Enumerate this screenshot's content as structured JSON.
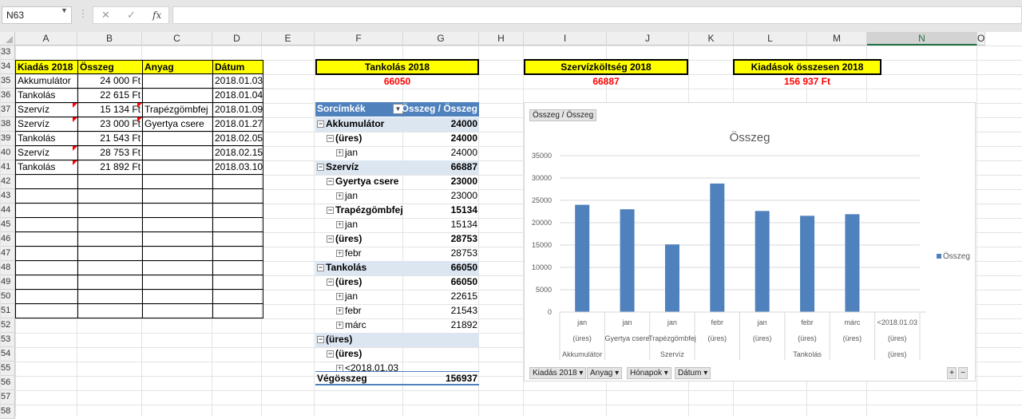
{
  "namebox": {
    "value": "N63"
  },
  "formula_bar": {
    "fx_label": "fx",
    "cancel": "✕",
    "enter": "✓",
    "content": ""
  },
  "columns": [
    "A",
    "B",
    "C",
    "D",
    "E",
    "F",
    "G",
    "H",
    "I",
    "J",
    "K",
    "L",
    "M",
    "N",
    "O"
  ],
  "selected_column": "N",
  "rows": [
    "33",
    "34",
    "35",
    "36",
    "37",
    "38",
    "39",
    "40",
    "41",
    "42",
    "43",
    "44",
    "45",
    "46",
    "47",
    "48",
    "49",
    "50",
    "51",
    "52",
    "53",
    "54",
    "55",
    "56",
    "57",
    "58"
  ],
  "table": {
    "headers": [
      "Kiadás 2018",
      "Összeg",
      "Anyag",
      "Dátum"
    ],
    "rows": [
      {
        "a": "Akkumulátor",
        "b": "24 000 Ft",
        "c": "",
        "d": "2018.01.03"
      },
      {
        "a": "Tankolás",
        "b": "22 615 Ft",
        "c": "",
        "d": "2018.01.04"
      },
      {
        "a": "Szervíz",
        "b": "15 134 Ft",
        "c": "Trapézgömbfej",
        "d": "2018.01.09"
      },
      {
        "a": "Szervíz",
        "b": "23 000 Ft",
        "c": "Gyertya csere",
        "d": "2018.01.27"
      },
      {
        "a": "Tankolás",
        "b": "21 543 Ft",
        "c": "",
        "d": "2018.02.05"
      },
      {
        "a": "Szervíz",
        "b": "28 753 Ft",
        "c": "",
        "d": "2018.02.15"
      },
      {
        "a": "Tankolás",
        "b": "21 892 Ft",
        "c": "",
        "d": "2018.03.10"
      }
    ]
  },
  "summary": {
    "tankolas_title": "Tankolás 2018",
    "tankolas_value": "66050",
    "szerviz_title": "Szervízköltség 2018",
    "szerviz_value": "66887",
    "kiadasok_title": "Kiadások összesen 2018",
    "kiadasok_value": "156 937 Ft"
  },
  "pivot": {
    "row_label_header": "Sorcímkék",
    "value_header": "Összeg / Összeg",
    "rows": [
      {
        "level": 0,
        "toggle": "⊟",
        "label": "Akkumulátor",
        "value": "24000",
        "bold": true,
        "band": true
      },
      {
        "level": 1,
        "toggle": "⊟",
        "label": "(üres)",
        "value": "24000",
        "bold": true,
        "band": false
      },
      {
        "level": 2,
        "toggle": "⊞",
        "label": "jan",
        "value": "24000",
        "bold": false,
        "band": false
      },
      {
        "level": 0,
        "toggle": "⊟",
        "label": "Szervíz",
        "value": "66887",
        "bold": true,
        "band": true
      },
      {
        "level": 1,
        "toggle": "⊟",
        "label": "Gyertya csere",
        "value": "23000",
        "bold": true,
        "band": false
      },
      {
        "level": 2,
        "toggle": "⊞",
        "label": "jan",
        "value": "23000",
        "bold": false,
        "band": false
      },
      {
        "level": 1,
        "toggle": "⊟",
        "label": "Trapézgömbfej",
        "value": "15134",
        "bold": true,
        "band": false
      },
      {
        "level": 2,
        "toggle": "⊞",
        "label": "jan",
        "value": "15134",
        "bold": false,
        "band": false
      },
      {
        "level": 1,
        "toggle": "⊟",
        "label": "(üres)",
        "value": "28753",
        "bold": true,
        "band": false
      },
      {
        "level": 2,
        "toggle": "⊞",
        "label": "febr",
        "value": "28753",
        "bold": false,
        "band": false
      },
      {
        "level": 0,
        "toggle": "⊟",
        "label": "Tankolás",
        "value": "66050",
        "bold": true,
        "band": true
      },
      {
        "level": 1,
        "toggle": "⊟",
        "label": "(üres)",
        "value": "66050",
        "bold": true,
        "band": false
      },
      {
        "level": 2,
        "toggle": "⊞",
        "label": "jan",
        "value": "22615",
        "bold": false,
        "band": false
      },
      {
        "level": 2,
        "toggle": "⊞",
        "label": "febr",
        "value": "21543",
        "bold": false,
        "band": false
      },
      {
        "level": 2,
        "toggle": "⊞",
        "label": "márc",
        "value": "21892",
        "bold": false,
        "band": false
      },
      {
        "level": 0,
        "toggle": "⊟",
        "label": "(üres)",
        "value": "",
        "bold": true,
        "band": true
      },
      {
        "level": 1,
        "toggle": "⊟",
        "label": "(üres)",
        "value": "",
        "bold": true,
        "band": false
      },
      {
        "level": 2,
        "toggle": "⊞",
        "label": "<2018.01.03",
        "value": "",
        "bold": false,
        "band": false
      }
    ],
    "grand_total_label": "Végösszeg",
    "grand_total_value": "156937"
  },
  "chart_data": {
    "type": "bar",
    "title": "Összeg",
    "value_field_button": "Összeg / Összeg",
    "series": [
      {
        "name": "Összeg",
        "values": [
          24000,
          23000,
          15134,
          28753,
          22615,
          21543,
          21892,
          0
        ]
      }
    ],
    "categories_level1": [
      "jan",
      "jan",
      "jan",
      "febr",
      "jan",
      "febr",
      "márc",
      "<2018.01.03"
    ],
    "categories_level2": [
      "(üres)",
      "Gyertya csere",
      "Trapézgömbfej",
      "(üres)",
      "(üres)",
      "(üres)",
      "(üres)",
      "(üres)"
    ],
    "categories_level3": [
      "Akkumulátor",
      "Szervíz",
      "Tankolás",
      "(üres)"
    ],
    "ylim": [
      0,
      35000
    ],
    "yticks": [
      0,
      5000,
      10000,
      15000,
      20000,
      25000,
      30000,
      35000
    ],
    "grid": true,
    "legend_position": "right",
    "bar_color": "#4f81bd",
    "field_buttons": [
      "Kiadás 2018",
      "Anyag",
      "Hónapok",
      "Dátum"
    ]
  }
}
